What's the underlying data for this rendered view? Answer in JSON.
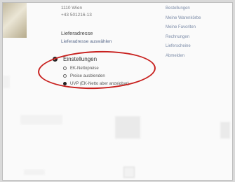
{
  "address": {
    "line1": "1110 Wien",
    "phone": "+43 501216-13"
  },
  "delivery": {
    "title": "Lieferadresse",
    "link": "Lieferadresse auswählen"
  },
  "side_menu": [
    {
      "label": "Bestellungen"
    },
    {
      "label": "Meine Warenkörbe"
    },
    {
      "label": "Meine Favoriten"
    },
    {
      "label": "Rechnungen"
    },
    {
      "label": "Lieferscheine"
    },
    {
      "label": "Abmelden"
    }
  ],
  "settings": {
    "title": "Einstellungen",
    "options": [
      {
        "label": "EK-Nettopreise",
        "selected": false
      },
      {
        "label": "Preise ausblenden",
        "selected": false
      },
      {
        "label": "UVP (EK-Netto aber anzeigbar)",
        "selected": true
      }
    ]
  },
  "highlight_color": "#c8201e"
}
